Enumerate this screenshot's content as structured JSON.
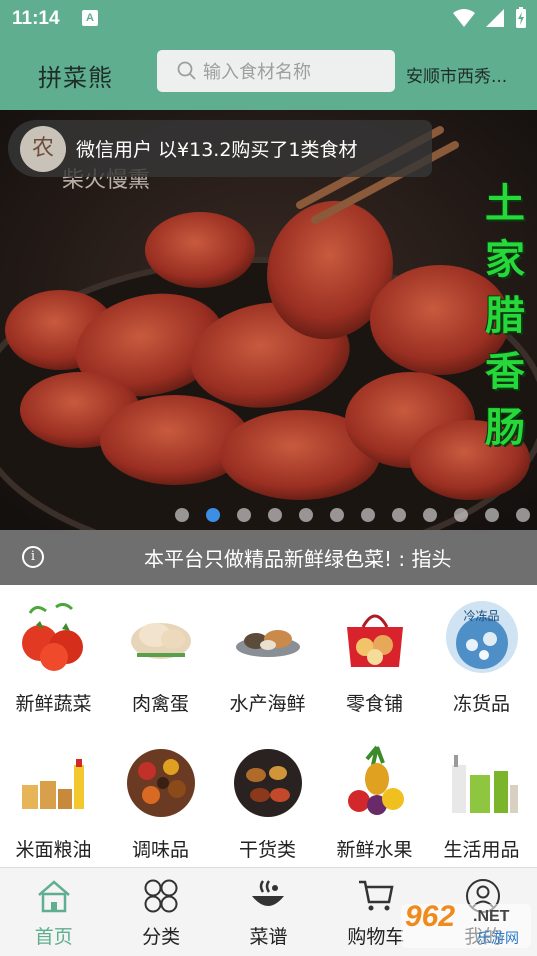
{
  "status_bar": {
    "time": "11:14",
    "app_indicator": "A"
  },
  "header": {
    "brand": "拼菜熊",
    "search_placeholder": "输入食材名称",
    "location": "安顺市西秀..."
  },
  "banner": {
    "ticker_avatar": "农",
    "ticker_text": "微信用户 以¥13.2购买了1类食材",
    "slogan_small": "柴火慢熏",
    "vertical_title": [
      "土",
      "家",
      "腊",
      "香",
      "肠"
    ],
    "dot_count": 12,
    "active_dot": 1
  },
  "notice": {
    "icon": "i",
    "text": "本平台只做精品新鲜绿色菜! : 指头"
  },
  "categories": [
    {
      "label": "新鲜蔬菜",
      "icon": "tomato-icon"
    },
    {
      "label": "肉禽蛋",
      "icon": "poultry-icon"
    },
    {
      "label": "水产海鲜",
      "icon": "seafood-icon"
    },
    {
      "label": "零食铺",
      "icon": "snack-bag-icon"
    },
    {
      "label": "冻货品",
      "icon": "frozen-icon"
    },
    {
      "label": "米面粮油",
      "icon": "grain-oil-icon"
    },
    {
      "label": "调味品",
      "icon": "spices-icon"
    },
    {
      "label": "干货类",
      "icon": "dried-goods-icon"
    },
    {
      "label": "新鲜水果",
      "icon": "fruit-icon"
    },
    {
      "label": "生活用品",
      "icon": "daily-goods-icon"
    }
  ],
  "frozen_badge": "冷冻品",
  "nav": [
    {
      "label": "首页",
      "icon": "home-icon",
      "active": true
    },
    {
      "label": "分类",
      "icon": "category-icon",
      "active": false
    },
    {
      "label": "菜谱",
      "icon": "recipe-icon",
      "active": false
    },
    {
      "label": "购物车",
      "icon": "cart-icon",
      "active": false
    },
    {
      "label": "我的",
      "icon": "profile-icon",
      "active": false
    }
  ],
  "watermark": {
    "number": "962",
    "suffix": ".NET",
    "cn": "乐游网"
  },
  "colors": {
    "accent": "#5fae8f",
    "notice_bg": "#6f6f6f",
    "active_dot": "#3d8fe6",
    "slogan_green": "#27d83a"
  }
}
